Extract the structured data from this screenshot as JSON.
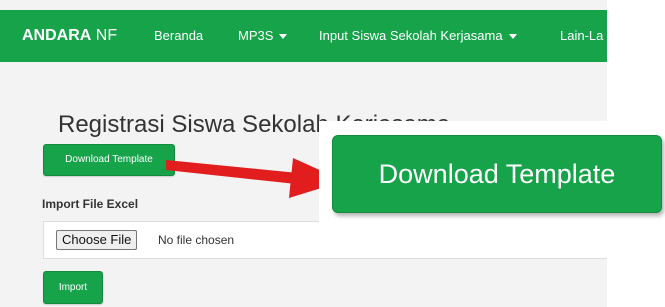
{
  "navbar": {
    "brand_bold": "ANDARA",
    "brand_rest": " NF",
    "items": [
      {
        "label": "Beranda"
      },
      {
        "label": "MP3S"
      },
      {
        "label": "Input Siswa Sekolah Kerjasama"
      },
      {
        "label": "Lain-La"
      }
    ]
  },
  "page": {
    "title": "Registrasi Siswa Sekolah Kerjasama",
    "download_button": "Download Template",
    "import_label": "Import File Excel",
    "choose_file_button": "Choose File",
    "file_status": "No file chosen",
    "import_button": "Import"
  },
  "callout": {
    "label": "Download Template"
  },
  "colors": {
    "brand_green": "#16a34a",
    "arrow_red": "#e11d1d",
    "page_bg": "#f3f3f3"
  },
  "icons": {
    "dropdown": "caret-down-icon",
    "pointer": "red-arrow-icon"
  }
}
